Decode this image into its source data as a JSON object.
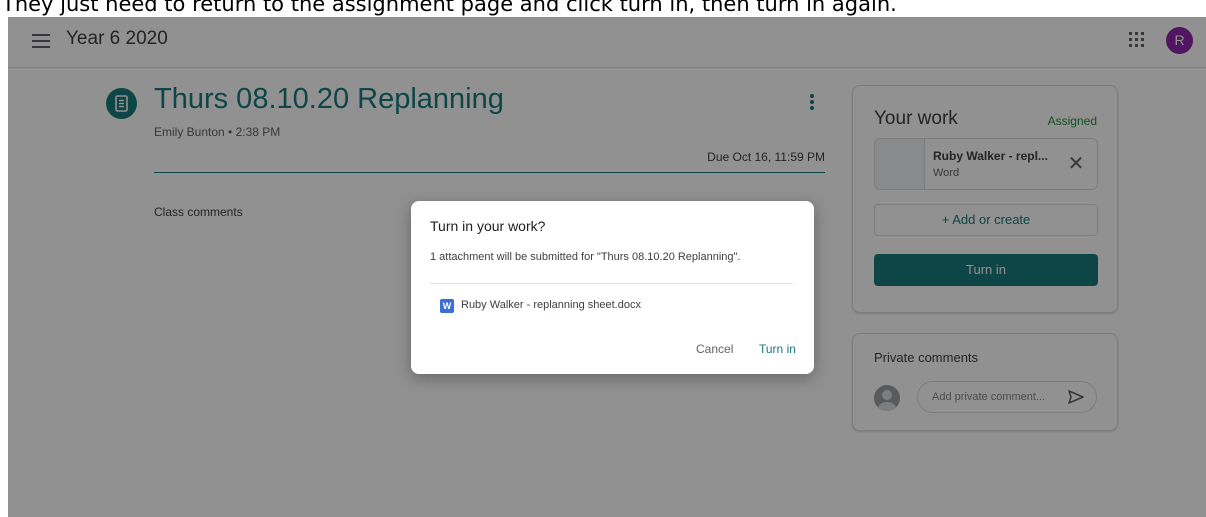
{
  "caption": "They just need to return to the assignment page and click turn in, then turn in again.",
  "header": {
    "class_name": "Year 6 2020",
    "avatar_letter": "R"
  },
  "assignment": {
    "title": "Thurs 08.10.20 Replanning",
    "meta": "Emily Bunton • 2:38 PM",
    "due": "Due Oct 16, 11:59 PM",
    "class_comments_label": "Class comments"
  },
  "your_work": {
    "title": "Your work",
    "status": "Assigned",
    "attachment_name": "Ruby Walker - repl...",
    "attachment_type": "Word",
    "add_label": "+ Add or create",
    "turn_in_label": "Turn in"
  },
  "private_comments": {
    "title": "Private comments",
    "placeholder": "Add private comment..."
  },
  "dialog": {
    "title": "Turn in your work?",
    "body": "1 attachment will be submitted for \"Thurs 08.10.20 Replanning\".",
    "file_icon_letter": "W",
    "file_name": "Ruby Walker - replanning sheet.docx",
    "cancel_label": "Cancel",
    "turn_in_label": "Turn in"
  },
  "colors": {
    "accent": "#1a7a7e",
    "status_green": "#1e8e3e",
    "avatar": "#8e24aa",
    "word_blue": "#3b6ed6"
  }
}
